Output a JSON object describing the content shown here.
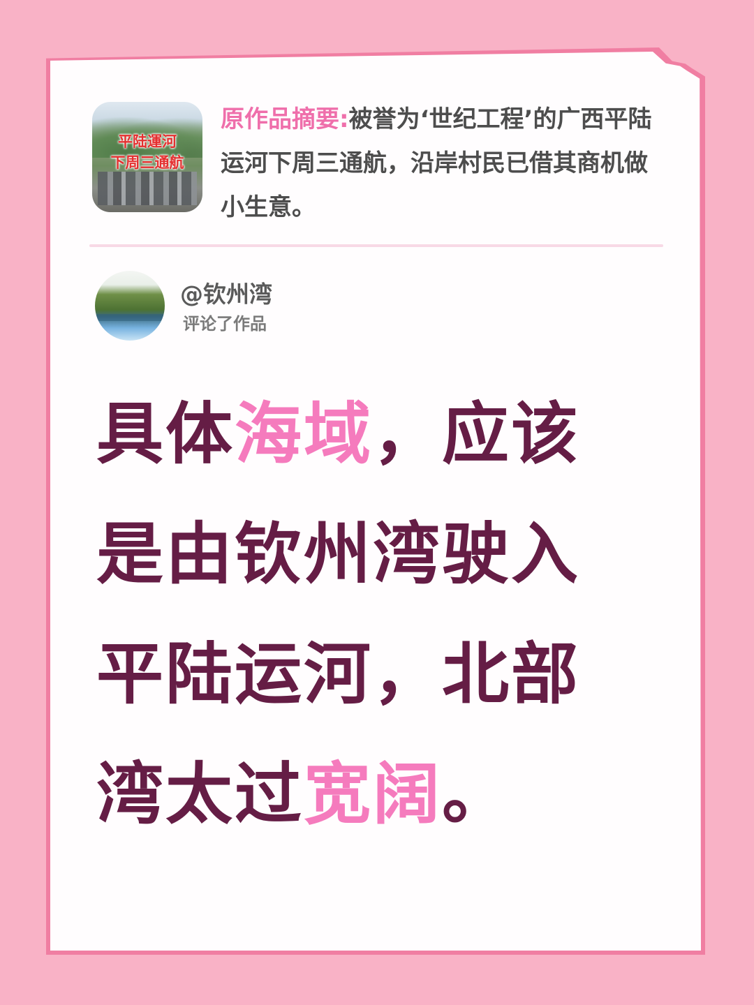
{
  "original_post": {
    "thumbnail_line1": "平陆運河",
    "thumbnail_line2": "下周三通航",
    "summary_label": "原作品摘要:",
    "summary_text": "被誉为‘世纪工程’的广西平陆运河下周三通航，沿岸村民已借其商机做小生意。"
  },
  "commenter": {
    "name": "@钦州湾",
    "action": "评论了作品"
  },
  "comment": {
    "line1": [
      "具体",
      "海域",
      "，应该"
    ],
    "line2": [
      "是由钦州湾驶入"
    ],
    "line3": [
      "平陆运河，北部"
    ],
    "line4": [
      "湾太过",
      "宽阔",
      "。"
    ]
  },
  "colors": {
    "background": "#f9b2c6",
    "card": "#fffdfe",
    "accent_pink": "#ef6fab",
    "highlight_pink": "#f57bbd",
    "comment_text": "#651d45"
  }
}
